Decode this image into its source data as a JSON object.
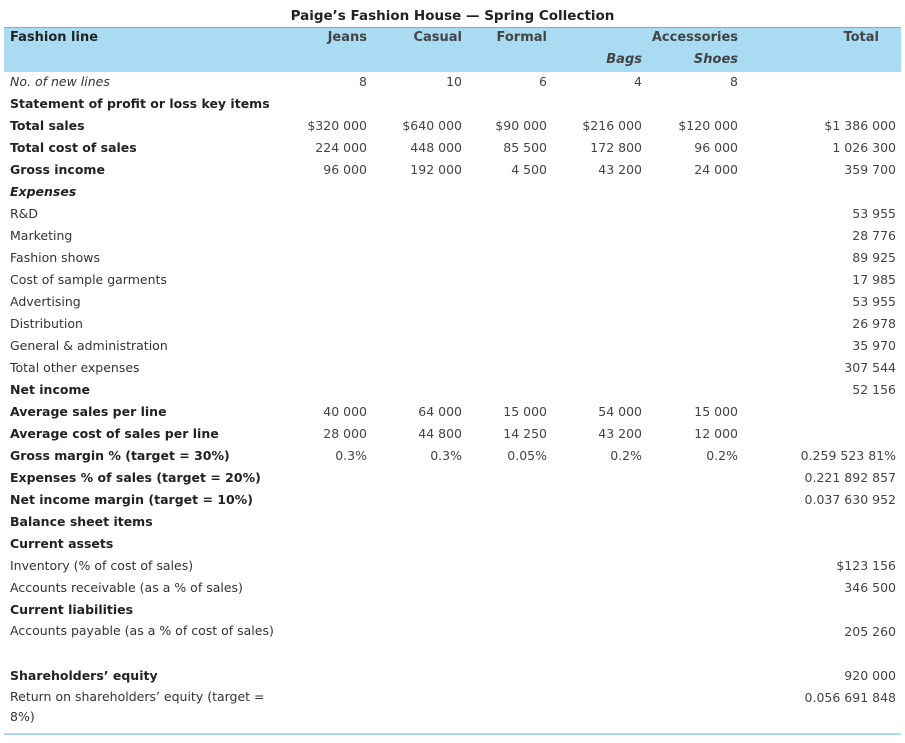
{
  "title": "Paige’s Fashion House — Spring Collection",
  "header": {
    "label": "Fashion line",
    "jeans": "Jeans",
    "casual": "Casual",
    "formal": "Formal",
    "accessories": "Accessories",
    "total": "Total",
    "bags": "Bags",
    "shoes": "Shoes"
  },
  "rows": [
    {
      "label": "No. of new lines",
      "style": "ital",
      "v": [
        "8",
        "10",
        "6",
        "4",
        "8",
        ""
      ]
    },
    {
      "label": "Statement of profit or loss key items",
      "style": "bold",
      "v": [
        "",
        "",
        "",
        "",
        "",
        ""
      ]
    },
    {
      "label": "Total sales",
      "style": "bold",
      "v": [
        "$320 000",
        "$640 000",
        "$90 000",
        "$216 000",
        "$120 000",
        "$1 386 000"
      ]
    },
    {
      "label": "Total cost of sales",
      "style": "bold",
      "v": [
        "224 000",
        "448 000",
        "85 500",
        "172 800",
        "96 000",
        "1 026 300"
      ]
    },
    {
      "label": "Gross income",
      "style": "bold",
      "v": [
        "96 000",
        "192 000",
        "4 500",
        "43 200",
        "24 000",
        "359 700"
      ]
    },
    {
      "label": "Expenses",
      "style": "bold ital",
      "v": [
        "",
        "",
        "",
        "",
        "",
        ""
      ]
    },
    {
      "label": "R&D",
      "style": "",
      "v": [
        "",
        "",
        "",
        "",
        "",
        "53 955"
      ]
    },
    {
      "label": "Marketing",
      "style": "",
      "v": [
        "",
        "",
        "",
        "",
        "",
        "28 776"
      ]
    },
    {
      "label": "Fashion shows",
      "style": "",
      "v": [
        "",
        "",
        "",
        "",
        "",
        "89 925"
      ]
    },
    {
      "label": "Cost of sample garments",
      "style": "",
      "v": [
        "",
        "",
        "",
        "",
        "",
        "17 985"
      ]
    },
    {
      "label": "Advertising",
      "style": "",
      "v": [
        "",
        "",
        "",
        "",
        "",
        "53 955"
      ]
    },
    {
      "label": "Distribution",
      "style": "",
      "v": [
        "",
        "",
        "",
        "",
        "",
        "26 978"
      ]
    },
    {
      "label": "General & administration",
      "style": "",
      "v": [
        "",
        "",
        "",
        "",
        "",
        "35 970"
      ]
    },
    {
      "label": "Total other expenses",
      "style": "",
      "v": [
        "",
        "",
        "",
        "",
        "",
        "307 544"
      ]
    },
    {
      "label": "Net income",
      "style": "bold",
      "v": [
        "",
        "",
        "",
        "",
        "",
        "52 156"
      ]
    },
    {
      "label": "Average sales per line",
      "style": "bold",
      "v": [
        "40 000",
        "64 000",
        "15 000",
        "54 000",
        "15 000",
        ""
      ]
    },
    {
      "label": "Average cost of sales per line",
      "style": "bold",
      "v": [
        "28 000",
        "44 800",
        "14 250",
        "43 200",
        "12 000",
        ""
      ]
    },
    {
      "label": "Gross margin % (target = 30%)",
      "style": "bold",
      "v": [
        "0.3%",
        "0.3%",
        "0.05%",
        "0.2%",
        "0.2%",
        "0.259 523 81%"
      ]
    },
    {
      "label": "Expenses % of sales (target = 20%)",
      "style": "bold",
      "v": [
        "",
        "",
        "",
        "",
        "",
        "0.221 892 857"
      ]
    },
    {
      "label": "Net income margin (target = 10%)",
      "style": "bold",
      "v": [
        "",
        "",
        "",
        "",
        "",
        "0.037 630 952"
      ]
    },
    {
      "label": "Balance sheet items",
      "style": "bold",
      "v": [
        "",
        "",
        "",
        "",
        "",
        ""
      ]
    },
    {
      "label": "Current assets",
      "style": "bold",
      "v": [
        "",
        "",
        "",
        "",
        "",
        ""
      ]
    },
    {
      "label": "Inventory (% of cost of sales)",
      "style": "",
      "v": [
        "",
        "",
        "",
        "",
        "",
        "$123 156"
      ]
    },
    {
      "label": "Accounts receivable (as a % of sales)",
      "style": "",
      "v": [
        "",
        "",
        "",
        "",
        "",
        "346 500"
      ]
    },
    {
      "label": "Current liabilities",
      "style": "bold",
      "v": [
        "",
        "",
        "",
        "",
        "",
        ""
      ]
    },
    {
      "label": "Accounts payable (as a % of cost of sales)",
      "style": "wrap",
      "v": [
        "",
        "",
        "",
        "",
        "",
        "205 260"
      ]
    },
    {
      "label": "Shareholders’ equity",
      "style": "bold",
      "v": [
        "",
        "",
        "",
        "",
        "",
        "920 000"
      ]
    },
    {
      "label": "Return on shareholders’ equity  (target = 8%)",
      "style": "wrap",
      "v": [
        "",
        "",
        "",
        "",
        "",
        "0.056 691 848"
      ]
    }
  ]
}
